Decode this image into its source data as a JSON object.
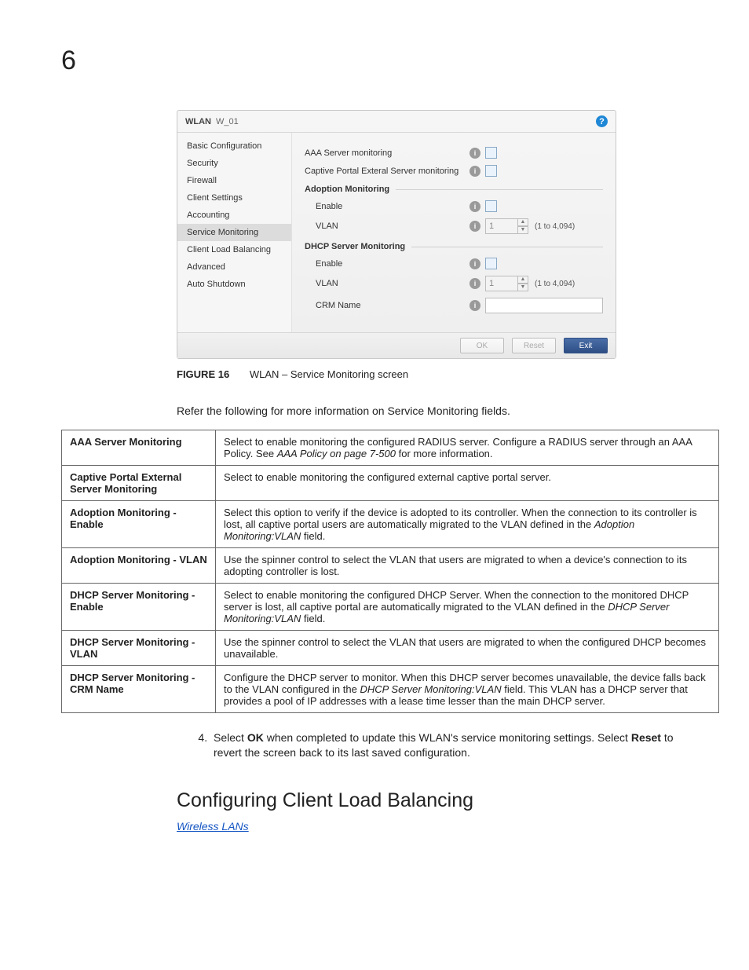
{
  "page_number": "6",
  "screenshot": {
    "title_prefix": "WLAN",
    "title_name": "W_01",
    "sidenav": [
      "Basic Configuration",
      "Security",
      "Firewall",
      "Client Settings",
      "Accounting",
      "Service Monitoring",
      "Client Load Balancing",
      "Advanced",
      "Auto Shutdown"
    ],
    "aaa_label": "AAA Server monitoring",
    "captive_label": "Captive Portal Exteral Server monitoring",
    "adoption_section": "Adoption Monitoring",
    "dhcp_section": "DHCP Server Monitoring",
    "enable_label": "Enable",
    "vlan_label": "VLAN",
    "crm_label": "CRM Name",
    "vlan_value": "1",
    "vlan_hint": "(1 to 4,094)",
    "buttons": {
      "ok": "OK",
      "reset": "Reset",
      "exit": "Exit"
    }
  },
  "figure": {
    "label": "FIGURE 16",
    "caption": "WLAN – Service Monitoring screen"
  },
  "intro_para": "Refer the following for more information on Service Monitoring fields.",
  "table": [
    {
      "k": "AAA Server Monitoring",
      "v_a": "Select to enable monitoring the configured RADIUS server. Configure a RADIUS server through an AAA Policy. See ",
      "v_i": "AAA Policy on page 7-500",
      "v_b": " for more information."
    },
    {
      "k": "Captive Portal External Server Monitoring",
      "v_a": "Select to enable monitoring the configured external captive portal server.",
      "v_i": "",
      "v_b": ""
    },
    {
      "k": "Adoption Monitoring - Enable",
      "v_a": "Select this option to verify if the device is adopted to its controller. When the connection to its controller is lost, all captive portal users are automatically migrated to the VLAN defined in the ",
      "v_i": "Adoption Monitoring:VLAN",
      "v_b": " field."
    },
    {
      "k": "Adoption Monitoring - VLAN",
      "v_a": "Use the spinner control to select the VLAN that users are migrated to when a device's connection to its adopting controller is lost.",
      "v_i": "",
      "v_b": ""
    },
    {
      "k": "DHCP Server Monitoring - Enable",
      "v_a": "Select to enable monitoring the configured DHCP Server. When the connection to the monitored DHCP server is lost, all captive portal are automatically migrated to the VLAN defined in the ",
      "v_i": "DHCP Server Monitoring:VLAN",
      "v_b": " field."
    },
    {
      "k": "DHCP Server Monitoring - VLAN",
      "v_a": "Use the spinner control to select the VLAN that users are migrated to when the configured DHCP becomes unavailable.",
      "v_i": "",
      "v_b": ""
    },
    {
      "k": "DHCP Server Monitoring - CRM Name",
      "v_a": "Configure the DHCP server to monitor. When this DHCP server becomes unavailable, the device falls back to the VLAN configured in the ",
      "v_i": "DHCP Server Monitoring:VLAN",
      "v_b": " field. This VLAN has a DHCP server that provides a pool of IP addresses with a lease time lesser than the main DHCP server."
    }
  ],
  "step": {
    "num": "4.",
    "a": "Select ",
    "ok": "OK",
    "b": " when completed to update this WLAN's service monitoring settings. Select ",
    "reset": "Reset",
    "c": " to revert the screen back to its last saved configuration."
  },
  "section_heading": "Configuring Client Load Balancing",
  "breadcrumb_link": "Wireless LANs"
}
